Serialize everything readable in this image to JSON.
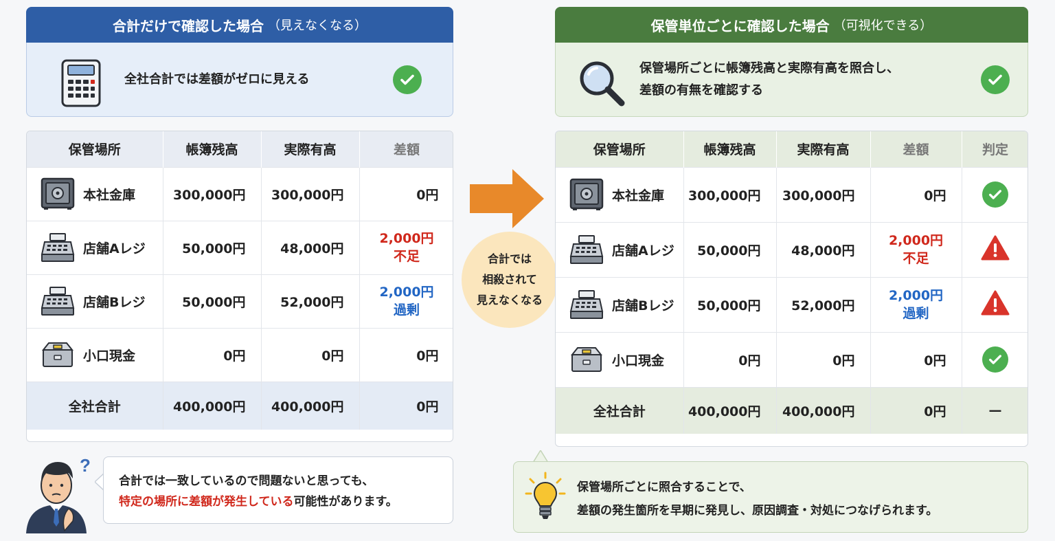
{
  "left": {
    "header_title": "合計だけで確認した場合",
    "header_sub": "（見えなくなる）",
    "summary": "全社合計では差額がゼロに見える",
    "columns": [
      "保管場所",
      "帳簿残高",
      "実際有高",
      "差額"
    ],
    "rows": [
      {
        "location": "本社金庫",
        "book": "300,000円",
        "actual": "300,000円",
        "diff1": "0円",
        "diff2": ""
      },
      {
        "location": "店舗Aレジ",
        "book": "50,000円",
        "actual": "48,000円",
        "diff1": "2,000円",
        "diff2": "不足"
      },
      {
        "location": "店舗Bレジ",
        "book": "50,000円",
        "actual": "52,000円",
        "diff1": "2,000円",
        "diff2": "過剰"
      },
      {
        "location": "小口現金",
        "book": "0円",
        "actual": "0円",
        "diff1": "0円",
        "diff2": ""
      }
    ],
    "total": {
      "label": "全社合計",
      "book": "400,000円",
      "actual": "400,000円",
      "diff": "0円"
    },
    "note_line1": "合計では一致しているので問題ないと思っても、",
    "note_highlight": "特定の場所に差額が発生している",
    "note_rest": "可能性があります。"
  },
  "middle": {
    "line1": "合計では",
    "line2": "相殺されて",
    "line3": "見えなくなる"
  },
  "right": {
    "header_title": "保管単位ごとに確認した場合",
    "header_sub": "（可視化できる）",
    "summary_line1": "保管場所ごとに帳簿残高と実際有高を照合し、",
    "summary_line2": "差額の有無を確認する",
    "columns": [
      "保管場所",
      "帳簿残高",
      "実際有高",
      "差額",
      "判定"
    ],
    "rows": [
      {
        "location": "本社金庫",
        "book": "300,000円",
        "actual": "300,000円",
        "diff1": "0円",
        "diff2": "",
        "judge": "ok"
      },
      {
        "location": "店舗Aレジ",
        "book": "50,000円",
        "actual": "48,000円",
        "diff1": "2,000円",
        "diff2": "不足",
        "judge": "warn"
      },
      {
        "location": "店舗Bレジ",
        "book": "50,000円",
        "actual": "52,000円",
        "diff1": "2,000円",
        "diff2": "過剰",
        "judge": "warn"
      },
      {
        "location": "小口現金",
        "book": "0円",
        "actual": "0円",
        "diff1": "0円",
        "diff2": "",
        "judge": "ok"
      }
    ],
    "total": {
      "label": "全社合計",
      "book": "400,000円",
      "actual": "400,000円",
      "diff": "0円",
      "judge": "—"
    },
    "note_line1": "保管場所ごとに照合することで、",
    "note_line2": "差額の発生箇所を早期に発見し、原因調査・対処につなげられます。"
  },
  "colors": {
    "blue_header": "#2e5ea6",
    "green_header": "#4a7c3f",
    "ok": "#4caf50",
    "warn": "#d9342b",
    "arrow": "#e8892a",
    "short": "#d0281c",
    "over": "#2266c4"
  }
}
